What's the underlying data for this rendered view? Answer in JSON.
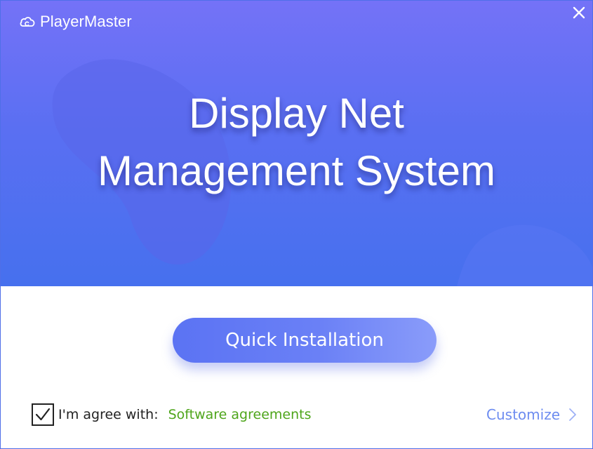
{
  "app": {
    "name": "PlayerMaster"
  },
  "hero": {
    "title_line1": "Display Net",
    "title_line2": "Management System"
  },
  "actions": {
    "install_label": "Quick Installation",
    "customize_label": "Customize"
  },
  "agreement": {
    "checked": true,
    "label": "I'm agree with:",
    "link": "Software agreements"
  },
  "icons": {
    "brand": "cloud-logo-icon",
    "close": "close-icon",
    "checkbox": "checkmark-icon",
    "customize": "chevron-right-icon"
  },
  "colors": {
    "hero_top": "#7472f7",
    "hero_bottom": "#4670ee",
    "button": "#6a80f6",
    "link_green": "#4ea51b",
    "customize_blue": "#6d8cf0"
  }
}
